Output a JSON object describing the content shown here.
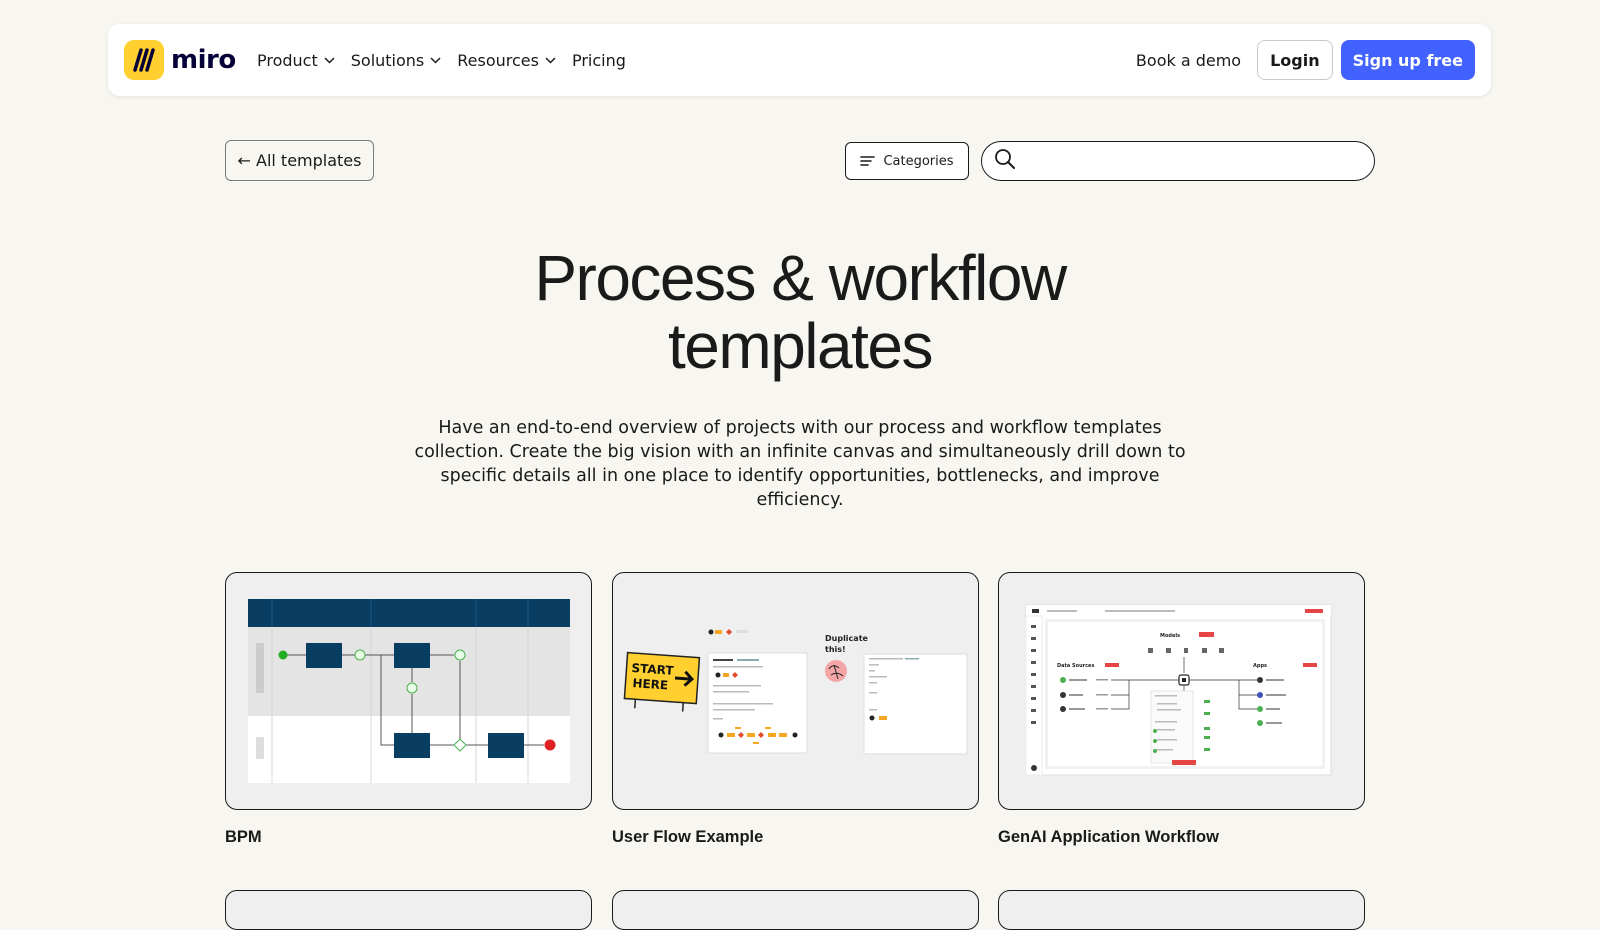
{
  "nav": {
    "logo_text": "miro",
    "links": [
      {
        "label": "Product",
        "has_dropdown": true
      },
      {
        "label": "Solutions",
        "has_dropdown": true
      },
      {
        "label": "Resources",
        "has_dropdown": true
      },
      {
        "label": "Pricing",
        "has_dropdown": false
      }
    ],
    "book_demo": "Book a demo",
    "login": "Login",
    "signup": "Sign up free"
  },
  "toolbar": {
    "back_label": "← All templates",
    "categories_label": "Categories",
    "search_placeholder": ""
  },
  "hero": {
    "title_line1": "Process & workflow",
    "title_line2": "templates",
    "description": "Have an end-to-end overview of projects with our process and workflow templates collection. Create the big vision with an infinite canvas and simultaneously drill down to specific details all in one place to identify opportunities, bottlenecks, and improve efficiency."
  },
  "cards": [
    {
      "title": "BPM"
    },
    {
      "title": "User Flow Example",
      "thumb_text": {
        "start": "START",
        "here": "HERE",
        "dup1": "Duplicate",
        "dup2": "this!"
      }
    },
    {
      "title": "GenAI Application Workflow",
      "thumb_text": {
        "models": "Models",
        "data": "Data Sources",
        "apps": "Apps"
      }
    }
  ],
  "colors": {
    "background": "#f8f6f0",
    "brand_yellow": "#ffd02f",
    "signup_blue": "#4262ff",
    "bpm_navy": "#0a3d62"
  }
}
